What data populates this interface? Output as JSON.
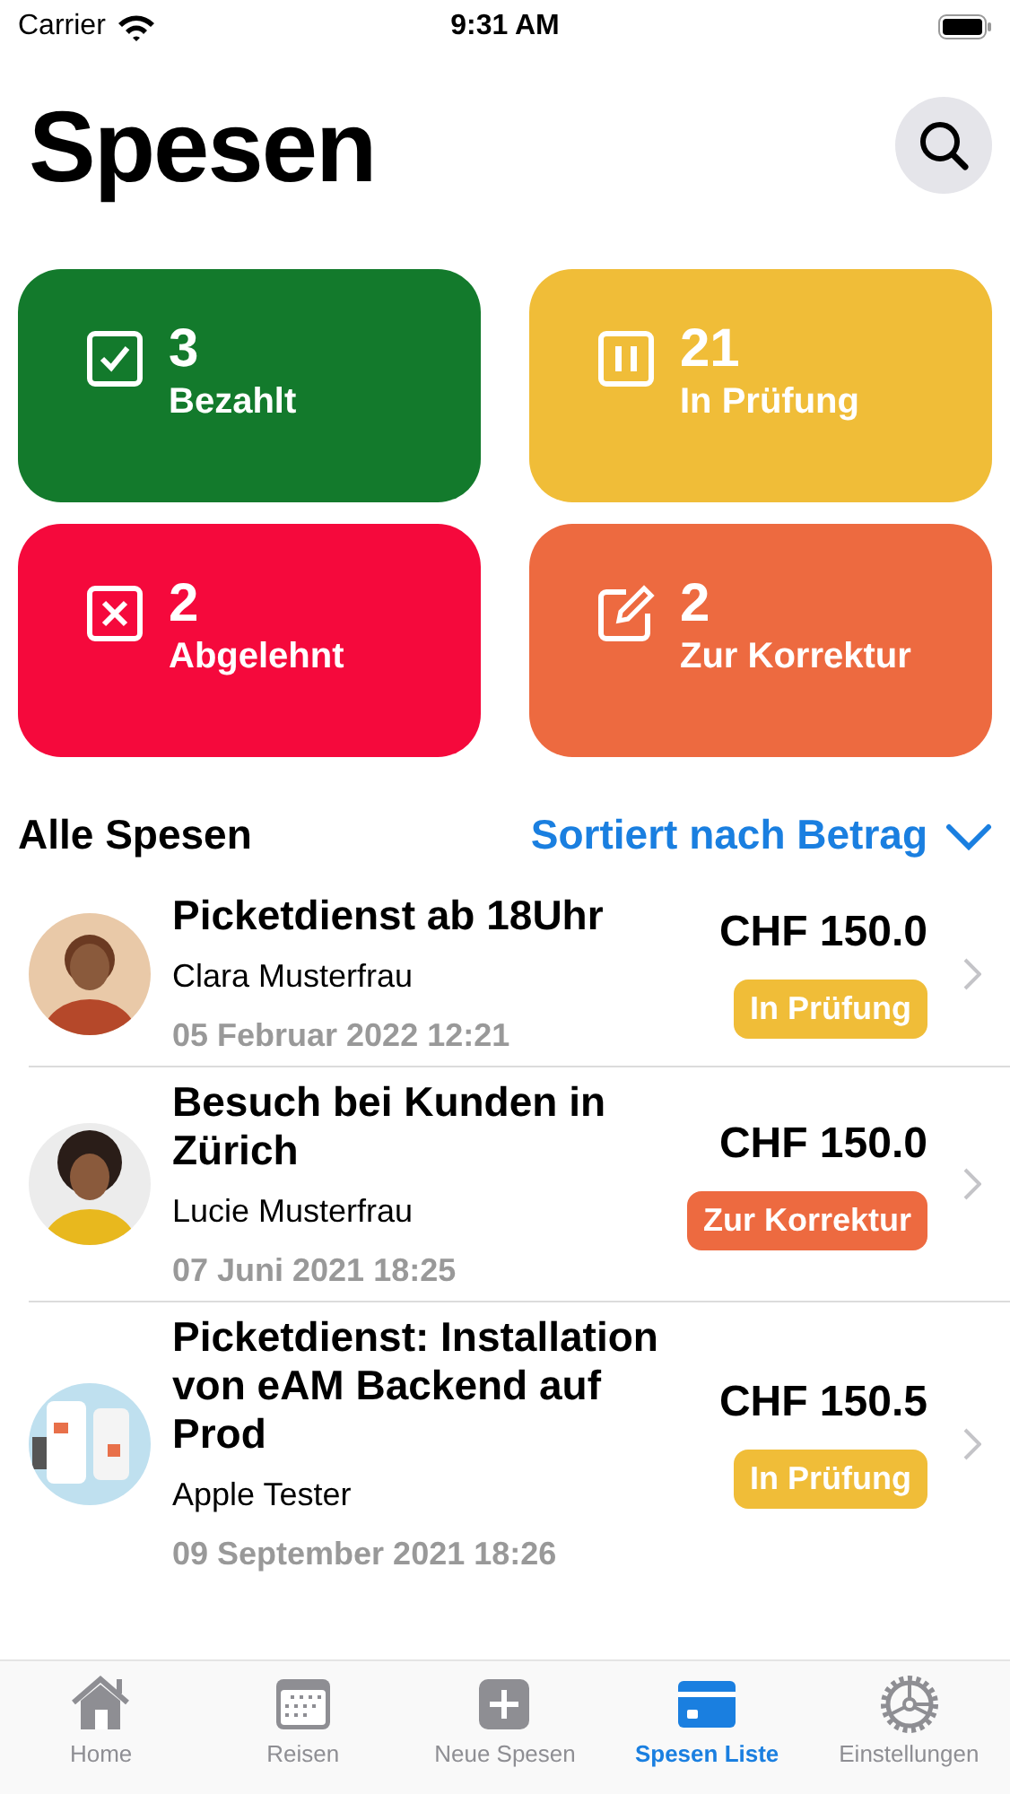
{
  "status_bar": {
    "carrier": "Carrier",
    "time": "9:31 AM"
  },
  "header": {
    "title": "Spesen"
  },
  "summary_tiles": [
    {
      "kind": "check",
      "count": "3",
      "label": "Bezahlt",
      "color": "#137a2c"
    },
    {
      "kind": "pause",
      "count": "21",
      "label": "In Prüfung",
      "color": "#f0bd38"
    },
    {
      "kind": "cross",
      "count": "2",
      "label": "Abgelehnt",
      "color": "#f5093c"
    },
    {
      "kind": "edit",
      "count": "2",
      "label": "Zur Korrektur",
      "color": "#ed6a40"
    }
  ],
  "list_header": {
    "title": "Alle Spesen",
    "sort": "Sortiert nach Betrag"
  },
  "expenses": [
    {
      "title": "Picketdienst ab 18Uhr",
      "person": "Clara Musterfrau",
      "date": "05 Februar 2022 12:21",
      "amount": "CHF 150.0",
      "status": {
        "label": "In Prüfung",
        "color": "#f0bd38"
      }
    },
    {
      "title": "Besuch bei Kunden in Zürich",
      "person": "Lucie Musterfrau",
      "date": "07 Juni 2021 18:25",
      "amount": "CHF 150.0",
      "status": {
        "label": "Zur Korrektur",
        "color": "#ed6a40"
      }
    },
    {
      "title": "Picketdienst: Installation von eAM Backend auf Prod",
      "person": "Apple Tester",
      "date": "09 September 2021 18:26",
      "amount": "CHF 150.5",
      "status": {
        "label": "In Prüfung",
        "color": "#f0bd38"
      }
    }
  ],
  "tabs": [
    {
      "kind": "home",
      "label": "Home",
      "selected": false
    },
    {
      "kind": "calendar",
      "label": "Reisen",
      "selected": false
    },
    {
      "kind": "plus",
      "label": "Neue Spesen",
      "selected": false
    },
    {
      "kind": "card",
      "label": "Spesen Liste",
      "selected": true
    },
    {
      "kind": "gear",
      "label": "Einstellungen",
      "selected": false
    }
  ]
}
